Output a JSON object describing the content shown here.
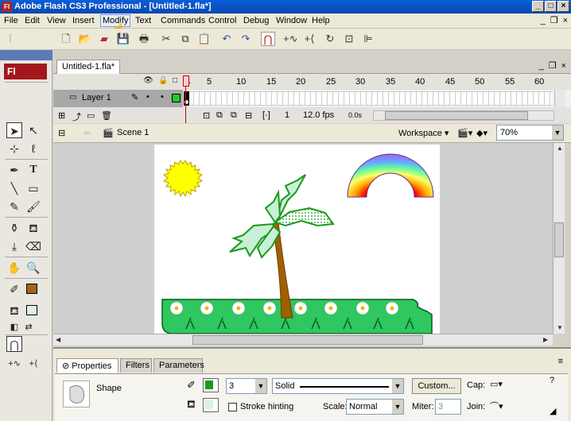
{
  "window": {
    "title": "Adobe Flash CS3 Professional - [Untitled-1.fla*]",
    "app_icon": "Fl"
  },
  "menu": [
    "File",
    "Edit",
    "View",
    "Insert",
    "Modify",
    "Text",
    "Commands",
    "Control",
    "Debug",
    "Window",
    "Help"
  ],
  "menu_active": "Modify",
  "toolbar_icons": [
    "new-icon",
    "open-icon",
    "bridge-icon",
    "save-icon",
    "print-icon",
    "cut-icon",
    "copy-icon",
    "paste-icon",
    "undo-icon",
    "redo-icon",
    "snap-magnet-icon",
    "smooth-icon",
    "straighten-icon",
    "rotate-icon",
    "scale-icon",
    "align-icon"
  ],
  "tools_panel": {
    "badge": "Fl"
  },
  "document": {
    "tab": "Untitled-1.fla*"
  },
  "timeline": {
    "frame_numbers": [
      "1",
      "5",
      "10",
      "15",
      "20",
      "25",
      "30",
      "35",
      "40",
      "45",
      "50",
      "55",
      "60"
    ],
    "layer": "Layer 1",
    "current_frame": "1",
    "fps": "12.0 fps",
    "time": "0.0s"
  },
  "edit_bar": {
    "scene": "Scene 1",
    "workspace": "Workspace",
    "zoom": "70%"
  },
  "colors": {
    "stroke": "#1a9a1a",
    "fill": "#a0661a",
    "fill2": "#d9f2e6",
    "ground": "#2ec760",
    "sun": "#ffff00",
    "trunk": "#a06000"
  },
  "properties": {
    "tabs": [
      "Properties",
      "Filters",
      "Parameters"
    ],
    "object_type": "Shape",
    "stroke_height": "3",
    "stroke_style": "Solid",
    "custom_button": "Custom...",
    "cap_label": "Cap:",
    "stroke_hinting": "Stroke hinting",
    "scale_label": "Scale:",
    "scale_value": "Normal",
    "miter_label": "Miter:",
    "miter_value": "3",
    "join_label": "Join:"
  }
}
